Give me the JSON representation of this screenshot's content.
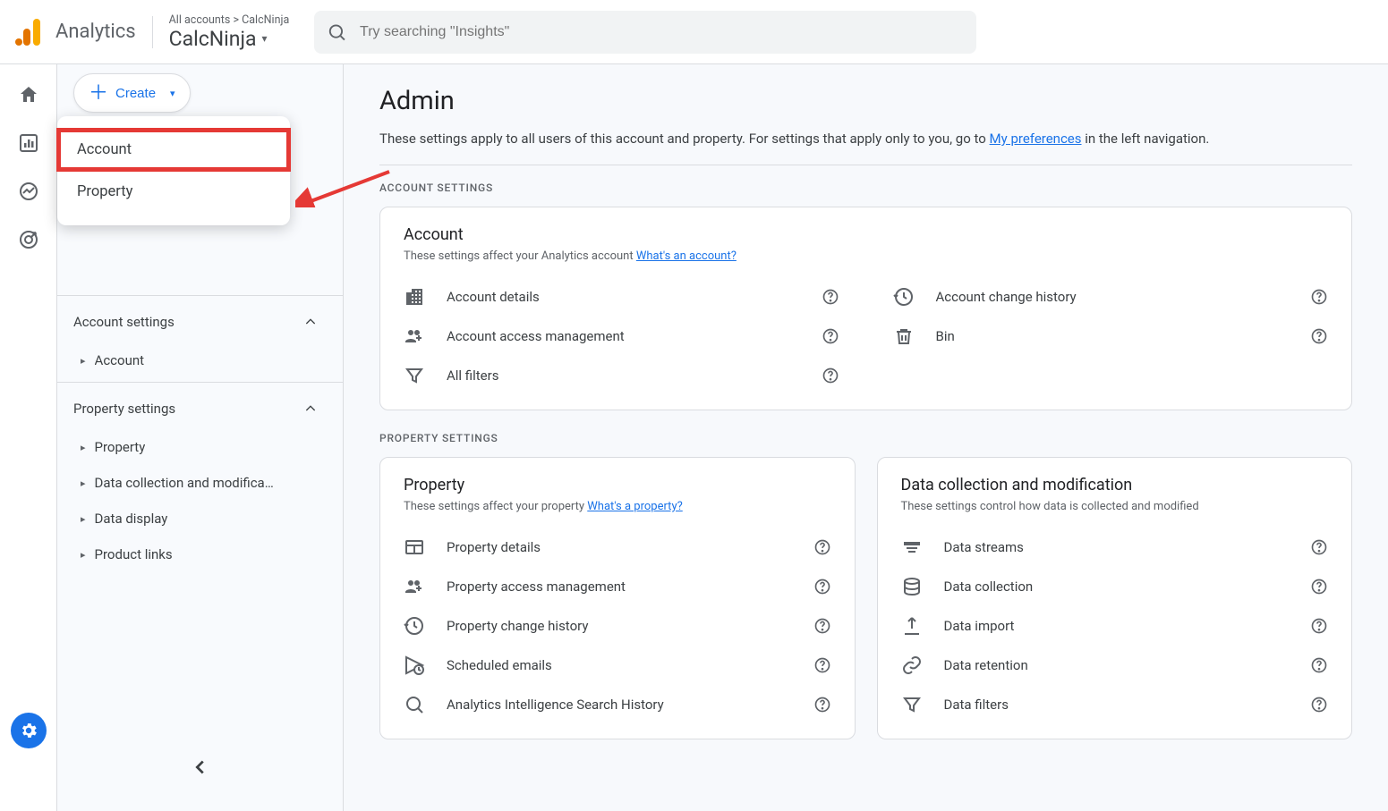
{
  "header": {
    "product": "Analytics",
    "breadcrumb_prefix": "All accounts",
    "breadcrumb_separator": ">",
    "breadcrumb_account": "CalcNinja",
    "selected_property": "CalcNinja",
    "search_placeholder": "Try searching \"Insights\""
  },
  "create_button": {
    "label": "Create"
  },
  "create_menu": {
    "item_account": "Account",
    "item_property": "Property"
  },
  "sidebar": {
    "account_settings": "Account settings",
    "nav_account": "Account",
    "property_settings": "Property settings",
    "nav_property": "Property",
    "nav_data_collection": "Data collection and modifica…",
    "nav_data_display": "Data display",
    "nav_product_links": "Product links"
  },
  "main": {
    "title": "Admin",
    "subtitle_pre": "These settings apply to all users of this account and property. For settings that apply only to you, go to ",
    "subtitle_link": "My preferences",
    "subtitle_post": " in the left navigation.",
    "account_settings_label": "ACCOUNT SETTINGS",
    "property_settings_label": "PROPERTY SETTINGS"
  },
  "account_panel": {
    "title": "Account",
    "desc_pre": "These settings affect your Analytics account ",
    "desc_link": "What's an account?",
    "rows": {
      "details": "Account details",
      "access": "Account access management",
      "filters": "All filters",
      "history": "Account change history",
      "bin": "Bin"
    }
  },
  "property_panel": {
    "title": "Property",
    "desc_pre": "These settings affect your property ",
    "desc_link": "What's a property?",
    "rows": {
      "details": "Property details",
      "access": "Property access management",
      "history": "Property change history",
      "scheduled": "Scheduled emails",
      "search_history": "Analytics Intelligence Search History"
    }
  },
  "data_panel": {
    "title": "Data collection and modification",
    "desc": "These settings control how data is collected and modified",
    "rows": {
      "streams": "Data streams",
      "collection": "Data collection",
      "import": "Data import",
      "retention": "Data retention",
      "filters": "Data filters"
    }
  }
}
